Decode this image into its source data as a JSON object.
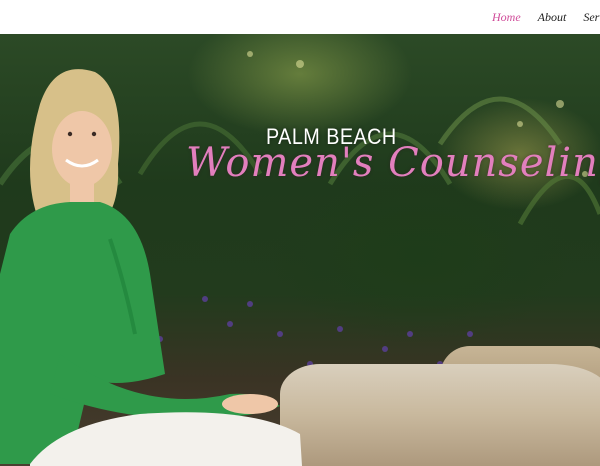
{
  "nav": {
    "items": [
      {
        "label": "Home",
        "active": true
      },
      {
        "label": "About",
        "active": false
      },
      {
        "label": "Serv",
        "active": false
      }
    ]
  },
  "hero": {
    "title_top": "PALM BEACH",
    "title_script": "Women's Counseling"
  },
  "colors": {
    "accent": "#d04c9a",
    "script": "#e27fbd",
    "nav_text": "#222222"
  }
}
